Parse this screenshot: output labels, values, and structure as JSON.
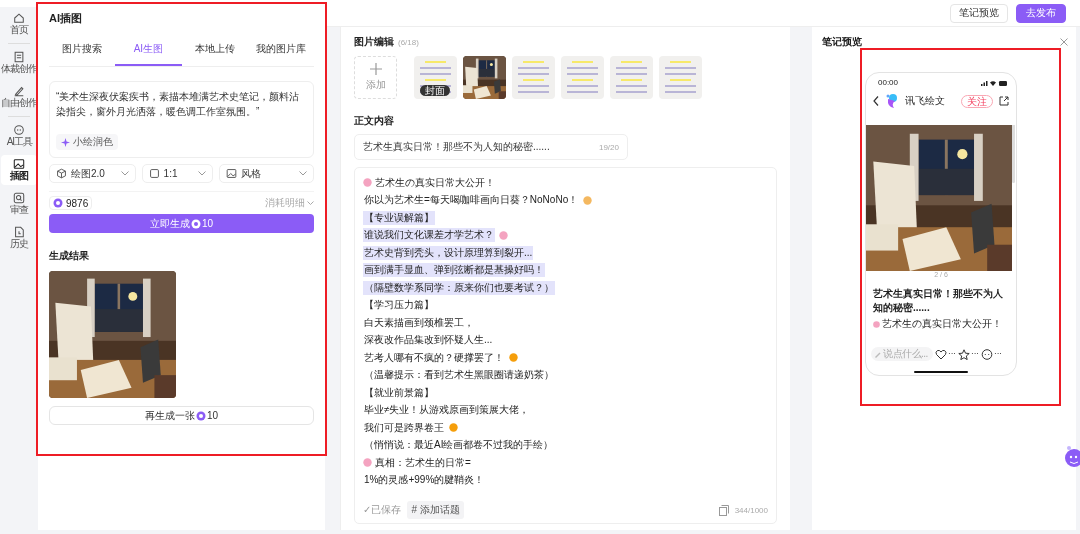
{
  "top_bar": {
    "buttons": [
      {
        "label": "笔记预览",
        "kind": "outline"
      },
      {
        "label": "去发布",
        "kind": "primary"
      }
    ]
  },
  "sidebar": {
    "items": [
      {
        "label": "首页",
        "selected": false,
        "divider_after": true
      },
      {
        "label": "体裁创作",
        "selected": false,
        "divider_after": false
      },
      {
        "label": "自由创作",
        "selected": false,
        "divider_after": true
      },
      {
        "label": "AI工具",
        "selected": false,
        "divider_after": false
      },
      {
        "label": "插图",
        "selected": true,
        "divider_after": false
      },
      {
        "label": "审查",
        "selected": false,
        "divider_after": false
      },
      {
        "label": "历史",
        "selected": false,
        "divider_after": false
      }
    ]
  },
  "illustration_panel": {
    "title": "AI插图",
    "tabs": [
      {
        "label": "图片搜索",
        "selected": false
      },
      {
        "label": "AI生图",
        "selected": true
      },
      {
        "label": "本地上传",
        "selected": false
      },
      {
        "label": "我的图片库",
        "selected": false
      }
    ],
    "prompt": "“美术生深夜伏案疾书，素描本堆满艺术史笔记，颜料沾染指尖，窗外月光洒落，暖色调工作室氛围。”",
    "polish_button": "小绘润色",
    "selects": [
      {
        "value": "绘图2.0"
      },
      {
        "value": "1:1"
      },
      {
        "value": "风格"
      }
    ],
    "credits": "9876",
    "cost_detail": "消耗明细",
    "generate_button": {
      "label": "立即生成",
      "cost": "10"
    },
    "result_title": "生成结果",
    "result_image": {
      "kind": "picture"
    },
    "regenerate_button": {
      "label": "再生成一张",
      "cost": "10"
    }
  },
  "editor": {
    "images_title": "图片编辑",
    "images_count": "(6/18)",
    "add_label": "添加",
    "thumbnails": [
      {
        "kind": "card",
        "badge": "封面"
      },
      {
        "kind": "picture"
      },
      {
        "kind": "card"
      },
      {
        "kind": "card"
      },
      {
        "kind": "card"
      },
      {
        "kind": "card"
      }
    ],
    "content_title": "正文内容",
    "title_field": {
      "value": "艺术生真实日常！那些不为人知的秘密......",
      "count": "19/20"
    },
    "body_lines": [
      {
        "text": "艺术生の真实日常大公开！",
        "highlighted": false,
        "lead_icon": true,
        "trail_icon": false
      },
      {
        "text": "你以为艺术生=每天喝咖啡画向日葵？NoNoNo！",
        "highlighted": false,
        "lead_icon": false,
        "trail_icon": true
      },
      {
        "text": "【专业误解篇】",
        "highlighted": true,
        "lead_icon": false,
        "trail_icon": false
      },
      {
        "text": "谁说我们文化课差才学艺术？",
        "highlighted": true,
        "lead_icon": false,
        "trail_icon": true
      },
      {
        "text": "艺术史背到秃头，设计原理算到裂开...",
        "highlighted": true,
        "lead_icon": false,
        "trail_icon": false
      },
      {
        "text": "画到满手显血、弹到弦断都是基操好吗！",
        "highlighted": true,
        "lead_icon": false,
        "trail_icon": false
      },
      {
        "text": "（隔壁数学系同学：原来你们也要考试？）",
        "highlighted": true,
        "lead_icon": false,
        "trail_icon": false
      },
      {
        "text": "【学习压力篇】",
        "highlighted": false,
        "lead_icon": false,
        "trail_icon": false
      },
      {
        "text": "白天素描画到颈椎罢工，",
        "highlighted": false,
        "lead_icon": false,
        "trail_icon": false
      },
      {
        "text": "深夜改作品集改到怀疑人生...",
        "highlighted": false,
        "lead_icon": false,
        "trail_icon": false
      },
      {
        "text": "艺考人哪有不疯的？硬撑罢了！",
        "highlighted": false,
        "lead_icon": false,
        "trail_icon": true
      },
      {
        "text": "（温馨提示：看到艺术生黑眼圈请递奶茶）",
        "highlighted": false,
        "lead_icon": false,
        "trail_icon": false
      },
      {
        "text": "【就业前景篇】",
        "highlighted": false,
        "lead_icon": false,
        "trail_icon": false
      },
      {
        "text": "毕业≠失业！从游戏原画到策展大佬，",
        "highlighted": false,
        "lead_icon": false,
        "trail_icon": false
      },
      {
        "text": "我们可是跨界卷王",
        "highlighted": false,
        "lead_icon": false,
        "trail_icon": true
      },
      {
        "text": "（悄悄说：最近AI绘画都卷不过我的手绘）",
        "highlighted": false,
        "lead_icon": false,
        "trail_icon": false
      },
      {
        "text": "真相：艺术生的日常=",
        "highlighted": false,
        "lead_icon": true,
        "trail_icon": false
      },
      {
        "text": "1%的灵感+99%的腱鞘炎！",
        "highlighted": false,
        "lead_icon": false,
        "trail_icon": false
      }
    ],
    "saved": "✓已保存",
    "topic_button": "# 添加话题",
    "char_count": "344/1000"
  },
  "preview": {
    "title": "笔记预览",
    "phone": {
      "time": "00:00",
      "author": "讯飞绘文",
      "follow": "关注",
      "image": {
        "kind": "picture"
      },
      "pager": "2 / 6",
      "note_title": "艺术生真实日常！那些不为人知的秘密......",
      "note_excerpt": "艺术生の真实日常大公开！",
      "comment_placeholder": "说点什么...",
      "likes": "···",
      "stars": "···",
      "comments": "···"
    }
  }
}
